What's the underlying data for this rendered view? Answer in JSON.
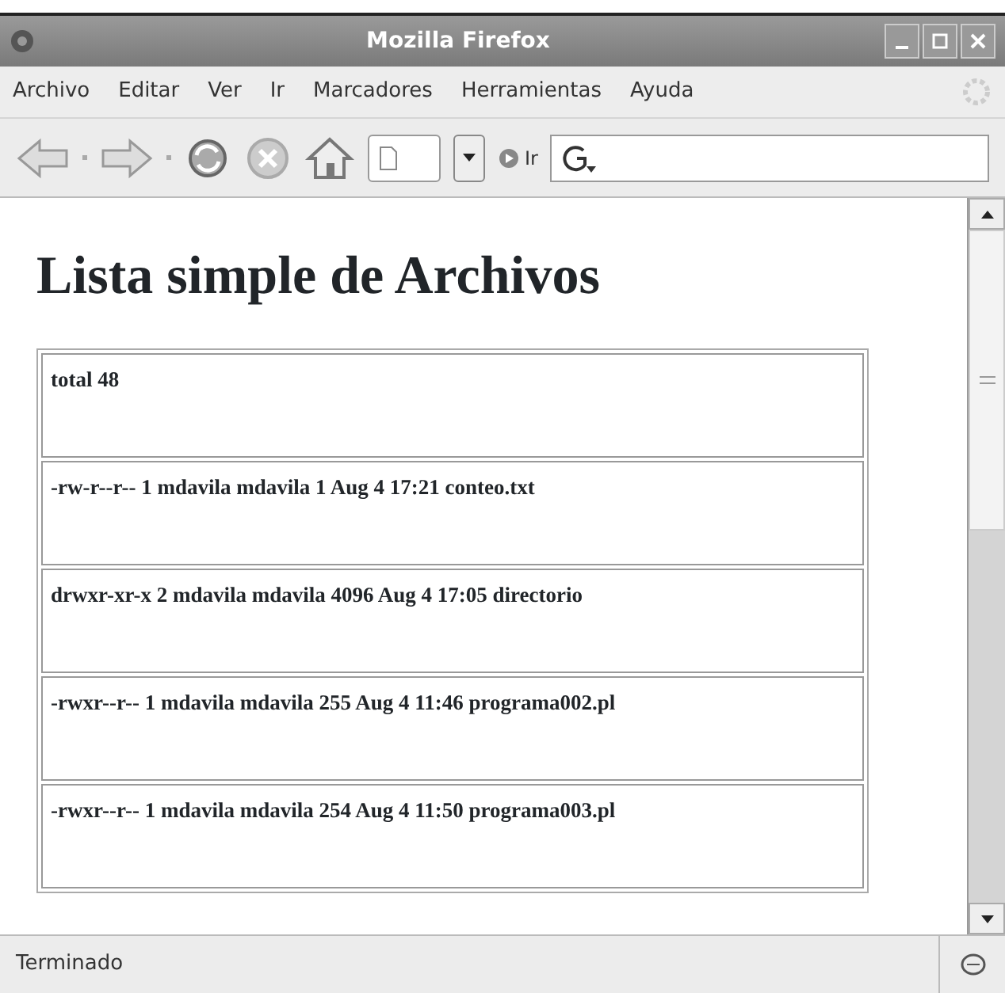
{
  "window": {
    "title": "Mozilla Firefox"
  },
  "menu": [
    "Archivo",
    "Editar",
    "Ver",
    "Ir",
    "Marcadores",
    "Herramientas",
    "Ayuda"
  ],
  "toolbar": {
    "go_label": "Ir"
  },
  "page": {
    "heading": "Lista simple de Archivos",
    "rows": [
      "total 48",
      "-rw-r--r-- 1 mdavila mdavila 1 Aug 4 17:21 conteo.txt",
      "drwxr-xr-x 2 mdavila mdavila 4096 Aug 4 17:05 directorio",
      "-rwxr--r-- 1 mdavila mdavila 255 Aug 4 11:46 programa002.pl",
      "-rwxr--r-- 1 mdavila mdavila 254 Aug 4 11:50 programa003.pl"
    ]
  },
  "status_bar": {
    "text": "Terminado"
  }
}
